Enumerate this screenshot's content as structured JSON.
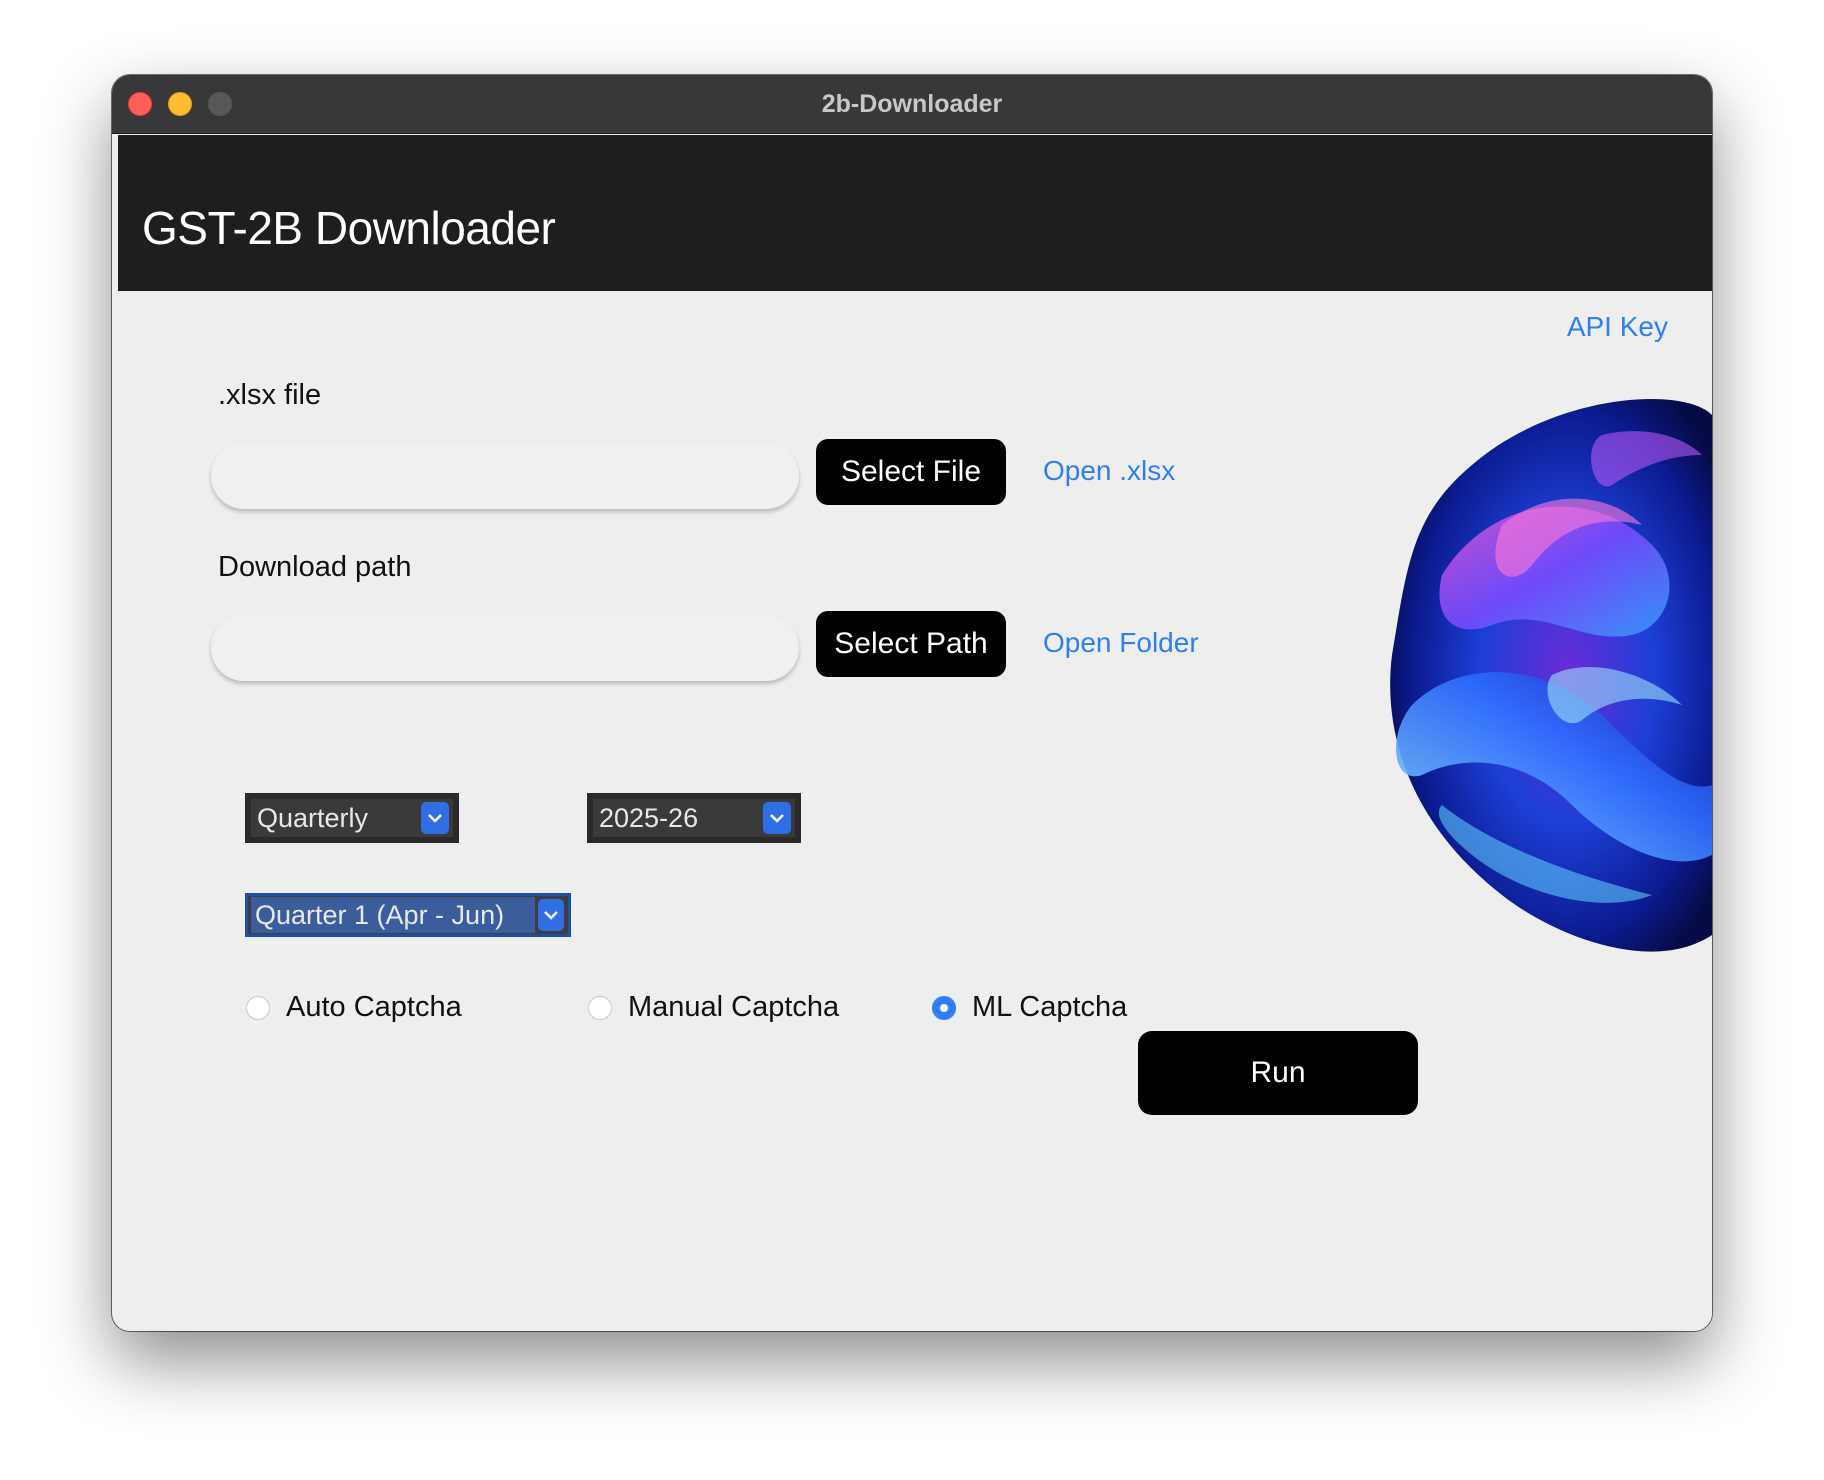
{
  "window": {
    "title": "2b-Downloader"
  },
  "header": {
    "title": "GST-2B Downloader"
  },
  "links": {
    "api_key": "API Key",
    "open_xlsx": "Open .xlsx",
    "open_folder": "Open Folder"
  },
  "file_section": {
    "label": ".xlsx file",
    "value": "",
    "button": "Select File"
  },
  "path_section": {
    "label": "Download path",
    "value": "",
    "button": "Select Path"
  },
  "selects": {
    "frequency": "Quarterly",
    "year": "2025-26",
    "period": "Quarter 1 (Apr - Jun)"
  },
  "captcha": {
    "options": [
      "Auto Captcha",
      "Manual Captcha",
      "ML Captcha"
    ],
    "selected": "ML Captcha"
  },
  "run_button": "Run",
  "colors": {
    "accent": "#2f7ff0",
    "button": "#000000",
    "header": "#1e1e20"
  },
  "icons": {
    "select_arrow": "chevron-down-icon",
    "artwork": "abstract-3d-swirl-graphic"
  }
}
